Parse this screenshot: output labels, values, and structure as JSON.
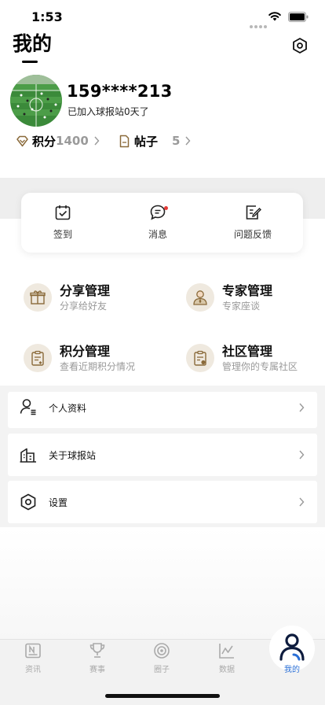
{
  "status_bar": {
    "time": "1:53"
  },
  "header": {
    "title": "我的"
  },
  "profile": {
    "phone": "159****213",
    "join_text": "已加入球报站0天了",
    "points_label": "积分",
    "points_value": "1400",
    "posts_label": "帖子",
    "posts_value": "5"
  },
  "quick_actions": [
    {
      "label": "签到",
      "icon": "calendar-check-icon"
    },
    {
      "label": "消息",
      "icon": "chat-bubble-icon",
      "has_badge": true
    },
    {
      "label": "问题反馈",
      "icon": "edit-note-icon"
    }
  ],
  "management": [
    {
      "title": "分享管理",
      "subtitle": "分享给好友",
      "icon": "gift-icon"
    },
    {
      "title": "专家管理",
      "subtitle": "专家座谈",
      "icon": "expert-icon"
    },
    {
      "title": "积分管理",
      "subtitle": "查看近期积分情况",
      "icon": "clipboard-icon"
    },
    {
      "title": "社区管理",
      "subtitle": "管理你的专属社区",
      "icon": "clipboard-chat-icon"
    }
  ],
  "menu": [
    {
      "label": "个人资料",
      "icon": "profile-icon"
    },
    {
      "label": "关于球报站",
      "icon": "building-icon"
    },
    {
      "label": "设置",
      "icon": "settings-icon"
    }
  ],
  "tabs": [
    {
      "label": "资讯",
      "icon": "news-icon"
    },
    {
      "label": "赛事",
      "icon": "trophy-icon"
    },
    {
      "label": "圈子",
      "icon": "circle-icon"
    },
    {
      "label": "数据",
      "icon": "chart-icon"
    },
    {
      "label": "我的",
      "icon": "user-icon",
      "active": true
    }
  ],
  "colors": {
    "accent": "#2a6fd6",
    "badge": "#e53935",
    "icon_bg": "#efe9df",
    "icon_brown": "#8a6a3a"
  }
}
